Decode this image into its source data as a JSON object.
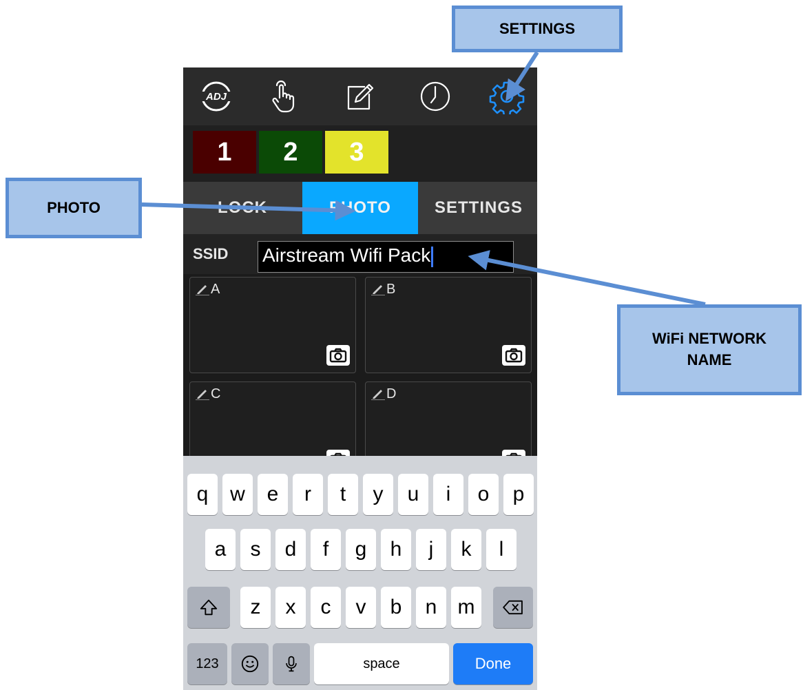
{
  "callouts": {
    "settings": "SETTINGS",
    "photo": "PHOTO",
    "wifi_line1": "WiFi NETWORK",
    "wifi_line2": "NAME"
  },
  "topbar": {
    "icons": [
      "adj-logo-icon",
      "touch-icon",
      "edit-icon",
      "clock-icon",
      "gear-icon"
    ],
    "logo_text": "ADJ",
    "active_color": "#1e90ff"
  },
  "presets": [
    {
      "label": "1",
      "color": "#4a0000"
    },
    {
      "label": "2",
      "color": "#0b4a06"
    },
    {
      "label": "3",
      "color": "#e3e32b"
    }
  ],
  "tabs": [
    {
      "label": "LOCK",
      "active": false
    },
    {
      "label": "PHOTO",
      "active": true,
      "color": "#0aa8ff"
    },
    {
      "label": "SETTINGS",
      "active": false
    }
  ],
  "ssid": {
    "label": "SSID",
    "value": "Airstream Wifi Pack"
  },
  "photo_slots": [
    "A",
    "B",
    "C",
    "D"
  ],
  "keyboard": {
    "row1": [
      "q",
      "w",
      "e",
      "r",
      "t",
      "y",
      "u",
      "i",
      "o",
      "p"
    ],
    "row2": [
      "a",
      "s",
      "d",
      "f",
      "g",
      "h",
      "j",
      "k",
      "l"
    ],
    "row3": [
      "z",
      "x",
      "c",
      "v",
      "b",
      "n",
      "m"
    ],
    "numbers_key": "123",
    "space_key": "space",
    "done_key": "Done"
  }
}
